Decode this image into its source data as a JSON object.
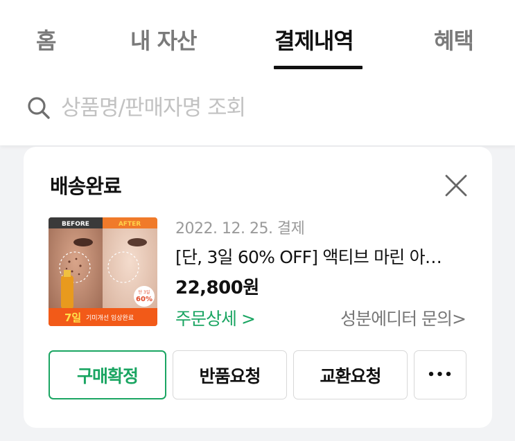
{
  "tabs": [
    {
      "label": "홈",
      "active": false
    },
    {
      "label": "내 자산",
      "active": false
    },
    {
      "label": "결제내역",
      "active": true
    },
    {
      "label": "혜택",
      "active": false
    }
  ],
  "search": {
    "placeholder": "상품명/판매자명 조회",
    "icon": "search-icon"
  },
  "order": {
    "status": "배송완료",
    "date": "2022. 12. 25. 결제",
    "title": "[단, 3일 60% OFF] 액티브 마린 아…",
    "price": "22,800원",
    "order_detail": "주문상세 >",
    "seller_inquiry": "성분에디터 문의>",
    "thumbnail": {
      "before_label": "BEFORE",
      "after_label": "AFTER",
      "badge_line1": "단 3일",
      "badge_line2": "60%",
      "banner_days": "7일",
      "banner_text": "기미개선 임상완료"
    },
    "buttons": {
      "confirm": "구매확정",
      "return": "반품요청",
      "exchange": "교환요청",
      "more": "•••"
    }
  },
  "colors": {
    "accent": "#1aa562",
    "text": "#111111",
    "muted": "#9a9a9a"
  }
}
